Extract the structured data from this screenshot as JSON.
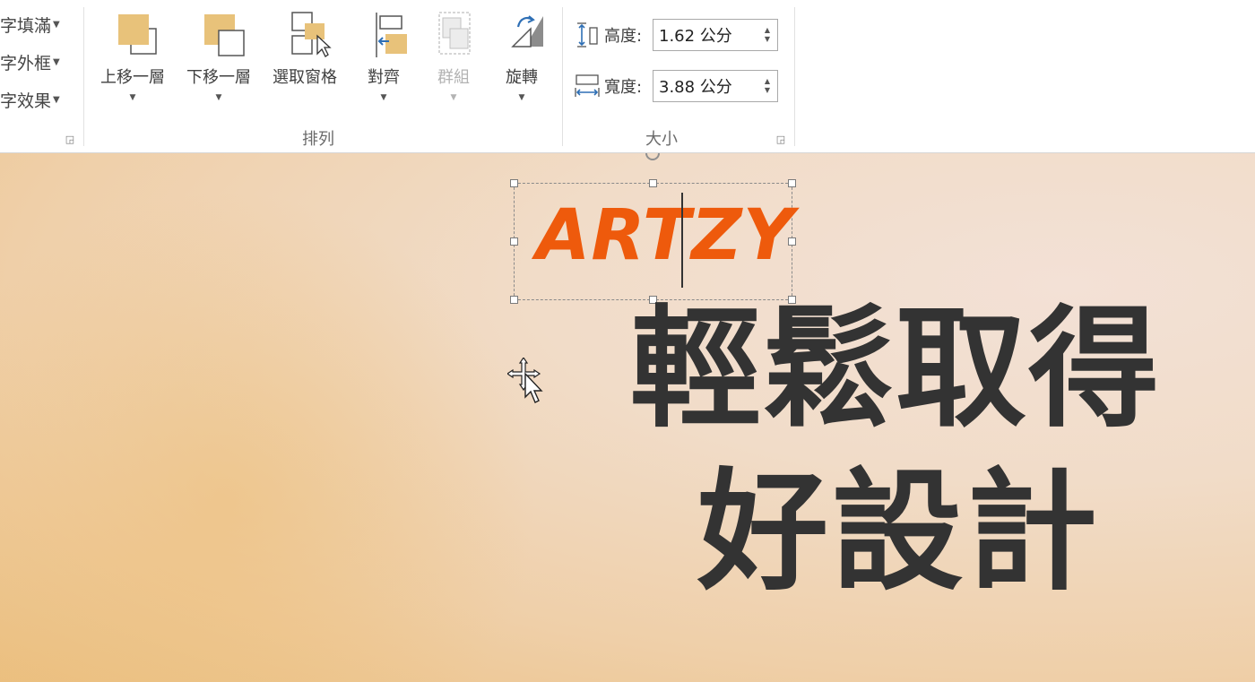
{
  "ribbon": {
    "wordart": {
      "fill_label": "字填滿",
      "outline_label": "字外框",
      "effects_label": "字效果"
    },
    "arrange": {
      "group_label": "排列",
      "bring_forward": "上移一層",
      "send_backward": "下移一層",
      "selection_pane": "選取窗格",
      "align": "對齊",
      "group": "群組",
      "rotate": "旋轉"
    },
    "size": {
      "group_label": "大小",
      "height_label": "高度:",
      "height_value": "1.62 公分",
      "width_label": "寬度:",
      "width_value": "3.88 公分"
    }
  },
  "slide": {
    "brand_text": "ARTZY",
    "headline_line1": "輕鬆取得",
    "headline_line2": "好設計"
  },
  "colors": {
    "brand_orange": "#ee5a0c",
    "headline_text": "#333333",
    "icon_gold": "#e8c27a"
  }
}
